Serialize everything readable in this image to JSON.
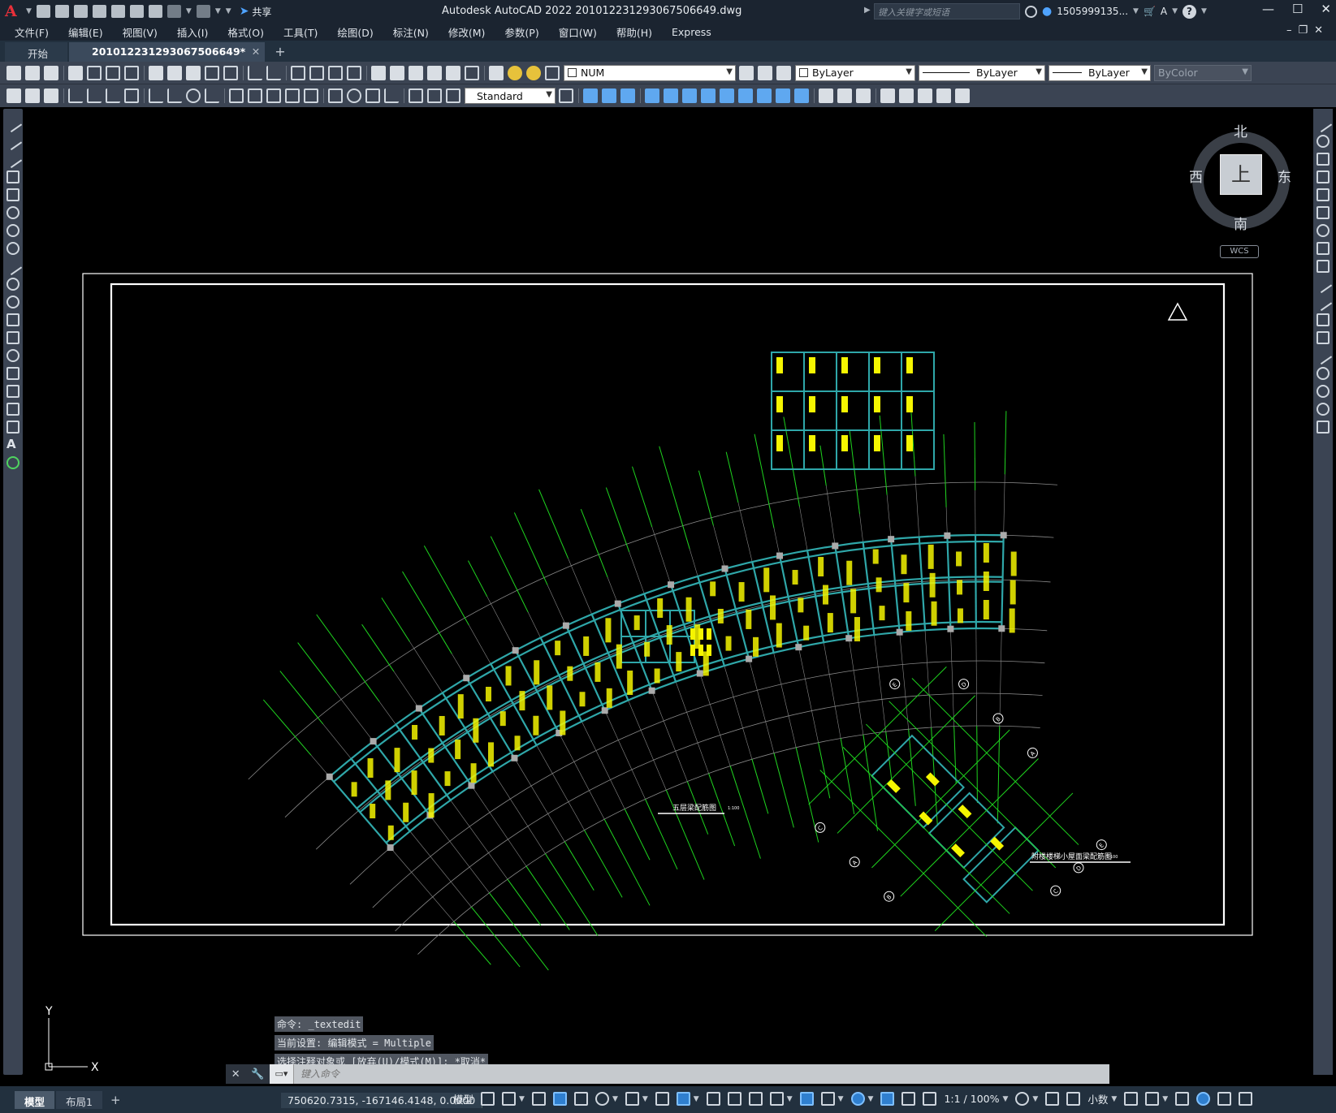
{
  "titlebar": {
    "app_title": "Autodesk AutoCAD 2022    20101223129306750664​9.dwg",
    "share_label": "共享",
    "search_placeholder": "键入关键字或短语",
    "user_name": "1505999135..."
  },
  "menubar": [
    "文件(F)",
    "编辑(E)",
    "视图(V)",
    "插入(I)",
    "格式(O)",
    "工具(T)",
    "绘图(D)",
    "标注(N)",
    "修改(M)",
    "参数(P)",
    "窗口(W)",
    "帮助(H)",
    "Express"
  ],
  "tabs": {
    "start": "开始",
    "drawing": "20101223129306750664​9*"
  },
  "toolbar": {
    "layer_value": "NUM",
    "color_value": "ByLayer",
    "linetype_value": "ByLayer",
    "lineweight_value": "ByLayer",
    "plotstyle_value": "ByColor",
    "textstyle_value": "Standard"
  },
  "viewcube": {
    "north": "北",
    "south": "南",
    "east": "东",
    "west": "西",
    "face": "上",
    "wcs": "WCS"
  },
  "drawing": {
    "main_plan_title": "五层梁配筋图",
    "main_plan_scale": "1:100",
    "stair_plan_title": "附楼楼梯小屋面梁配筋图",
    "stair_plan_scale": "1:100",
    "axis_labels_stair": [
      "E",
      "D",
      "B",
      "A",
      "C",
      "A",
      "B",
      "C",
      "D",
      "E"
    ]
  },
  "command": {
    "history": [
      "命令: _textedit",
      "当前设置: 编辑模式 = Multiple",
      "选择注释对象或 [放弃(U)/模式(M)]: *取消*"
    ],
    "placeholder": "键入命令"
  },
  "ucs": {
    "x": "X",
    "y": "Y"
  },
  "statusbar": {
    "tab_model": "模型",
    "tab_layout1": "布局1",
    "coordinates": "750620.7315, -167146.4148, 0.0000",
    "space": "模型",
    "scale": "1:1 / 100%",
    "units": "小数"
  },
  "colors": {
    "beam": "#2fa7a9",
    "axis": "#1ed31e",
    "text": "#f5f500",
    "grid": "#8a8a8a",
    "frame": "#ffffff"
  }
}
